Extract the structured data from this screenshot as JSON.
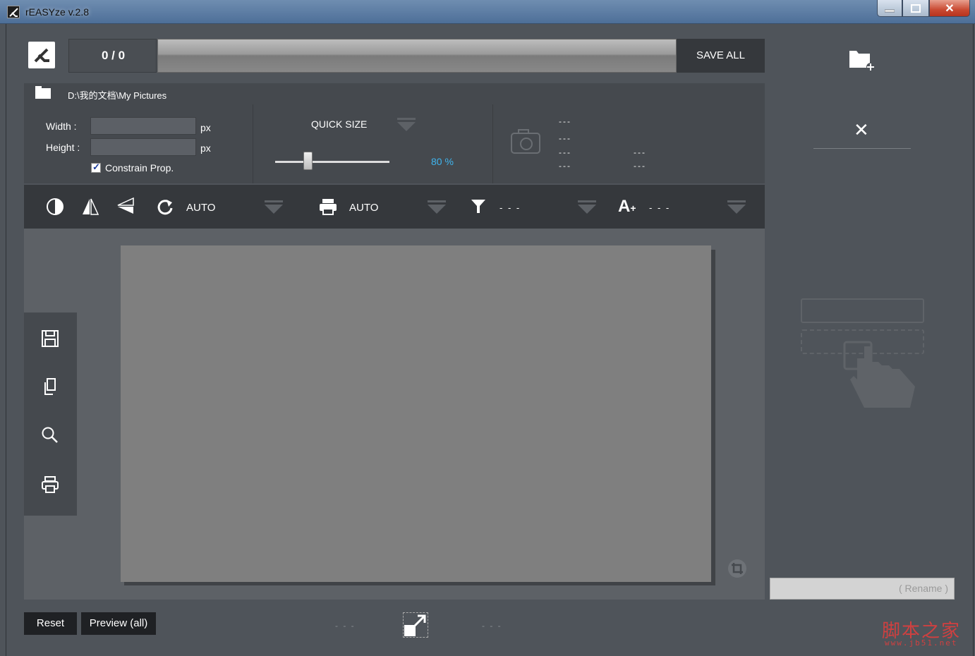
{
  "window": {
    "title": "rEASYze v.2.8",
    "controls": {
      "minimize": "‒",
      "maximize": "▫",
      "close": "✕"
    }
  },
  "topbar": {
    "counter": "0 / 0",
    "progress": 0,
    "save_all": "SAVE ALL"
  },
  "path": "D:\\我的文档\\My Pictures",
  "settings": {
    "width_label": "Width :",
    "height_label": "Height :",
    "px": "px",
    "width_value": "",
    "height_value": "",
    "constrain": "Constrain Prop.",
    "constrain_checked": true,
    "quick_size": "QUICK SIZE",
    "quick_size_pct": "80 %",
    "info": [
      "---",
      "---",
      "---",
      "---",
      "---",
      "---"
    ]
  },
  "toolbar": {
    "rotate_mode": "AUTO",
    "print_mode": "AUTO",
    "filter_value": "- - -",
    "text_value": "- - -"
  },
  "right": {
    "rename_placeholder": "( Rename )"
  },
  "bottom": {
    "reset": "Reset",
    "preview_all": "Preview (all)",
    "left_value": "- - -",
    "right_value": "- - -"
  },
  "watermark": {
    "main": "脚本之家",
    "sub": "www.jb51.net"
  },
  "icons": [
    "app-logo-icon",
    "folder-icon",
    "camera-icon",
    "contrast-icon",
    "flip-horizontal-icon",
    "flip-vertical-icon",
    "rotate-icon",
    "printer-icon",
    "filter-icon",
    "text-add-icon",
    "save-icon",
    "copy-icon",
    "search-icon",
    "print-icon",
    "crop-icon",
    "add-folder-icon",
    "close-icon",
    "drag-drop-icon",
    "expand-icon"
  ],
  "colors": {
    "accent": "#3fb4ee",
    "background": "#4f545a",
    "dark": "#35383c"
  }
}
